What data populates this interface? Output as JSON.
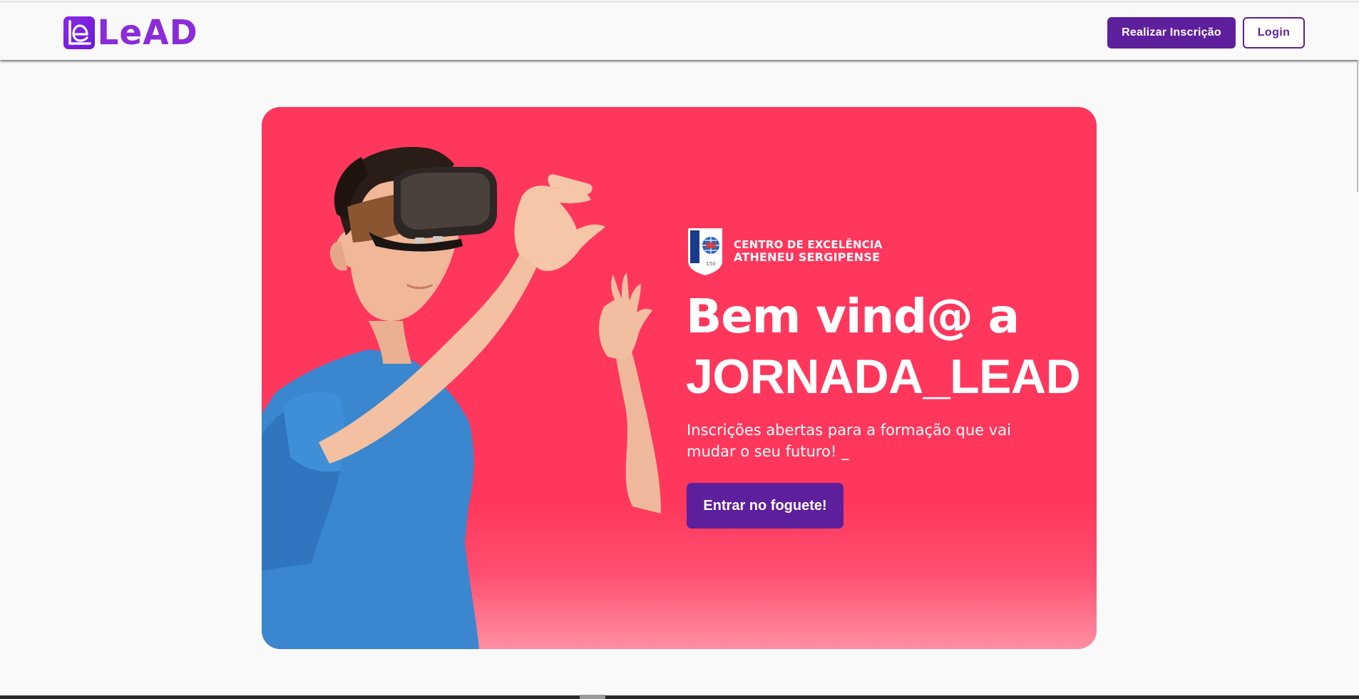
{
  "header": {
    "logo": {
      "mark_text": "le",
      "word": "LeAD",
      "icon": "lead-logo-icon"
    },
    "register_label": "Realizar Inscrição",
    "login_label": "Login"
  },
  "hero": {
    "background_color": "#ff375c",
    "brand": {
      "line1": "CENTRO DE EXCELÊNCIA",
      "line2": "ATHENEU SERGIPENSE",
      "shield_text": "ATHENEU",
      "shield_number": "150",
      "icon": "atheneu-shield-icon"
    },
    "title_line1": "Bem vind@ a",
    "title_line2": "JORNADA_LEAD",
    "subtitle": "Inscrições abertas para a formação que vai mudar o seu futuro! _",
    "cta_label": "Entrar no foguete!"
  },
  "colors": {
    "accent_purple": "#5e1f9c",
    "logo_purple": "#8c2bd8",
    "hero_pink": "#ff375c"
  }
}
